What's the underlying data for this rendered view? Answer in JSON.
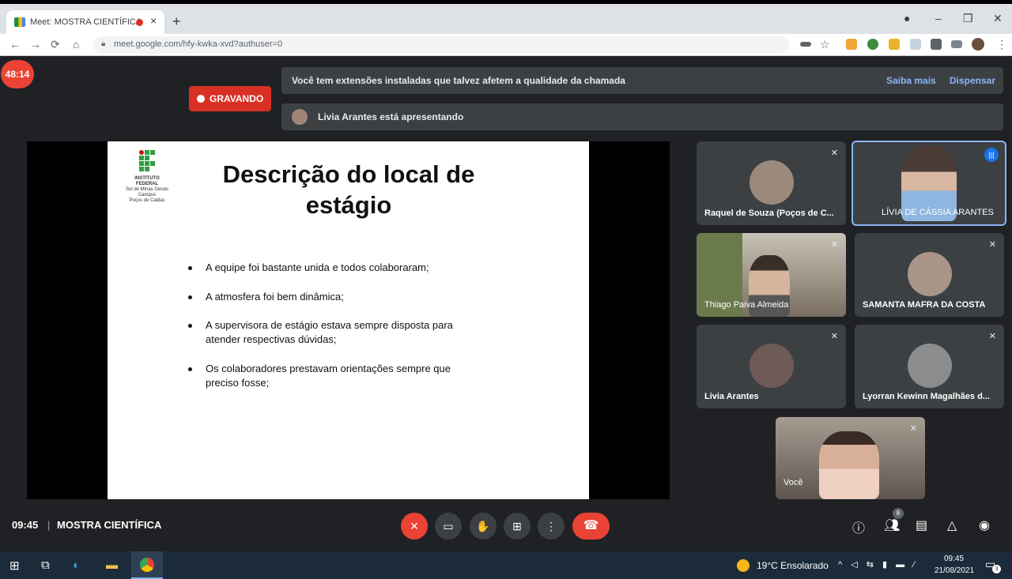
{
  "browser": {
    "tab_title": "Meet: MOSTRA CIENTÍFICA",
    "tab_close": "×",
    "new_tab": "+",
    "url": "meet.google.com/hfy-kwka-xvd?authuser=0",
    "window_controls": {
      "minimize": "–",
      "maximize": "❐",
      "close": "✕"
    }
  },
  "meet": {
    "timer": "48:14",
    "recording_label": "GRAVANDO",
    "extension_banner": {
      "message": "Você tem extensões instaladas que talvez afetem a qualidade da chamada",
      "learn_more": "Saiba mais",
      "dismiss": "Dispensar"
    },
    "presenting_banner": "Livia Arantes está apresentando",
    "slide": {
      "logo_lines": [
        "INSTITUTO",
        "FEDERAL",
        "Sul de Minas Gerais",
        "Campus",
        "Poços de Caldas"
      ],
      "title_line1": "Descrição do local de",
      "title_line2": "estágio",
      "bullets": [
        "A equipe foi bastante unida e todos colaboraram;",
        "A atmosfera foi bem dinâmica;",
        "A supervisora de estágio estava sempre disposta para atender respectivas dúvidas;",
        "Os colaboradores prestavam orientações sempre que preciso fosse;"
      ]
    },
    "participants": [
      {
        "name": "Raquel de Souza (Poços de C...",
        "muted": true
      },
      {
        "name": "LÍVIA DE CÁSSIA ARANTES",
        "speaking": true
      },
      {
        "name": "Thiago Paiva Almeida",
        "muted": true
      },
      {
        "name": "SAMANTA MAFRA DA COSTA",
        "muted": true
      },
      {
        "name": "Livia Arantes",
        "muted": true
      },
      {
        "name": "Lyorran Kewinn Magalhães d...",
        "muted": true
      },
      {
        "name": "Você",
        "muted": true
      }
    ],
    "bottom_bar": {
      "time": "09:45",
      "separator": "|",
      "meeting_name": "MOSTRA CIENTÍFICA",
      "people_count": "8"
    }
  },
  "taskbar": {
    "weather": "19°C  Ensolarado",
    "clock_time": "09:45",
    "clock_date": "21/08/2021",
    "notification_count": "3"
  },
  "colors": {
    "meet_background": "#202124",
    "danger_red": "#ea4335",
    "link_blue": "#8ab4f8",
    "ifsuldeminas_green": "#2f9e41"
  }
}
